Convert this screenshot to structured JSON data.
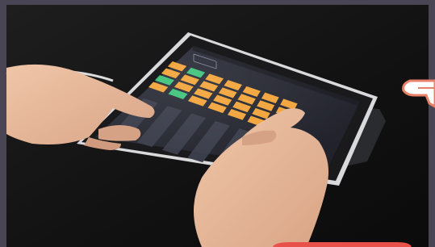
{
  "scene": {
    "subject": "hands-tapping-tablet",
    "colors": {
      "frame": "#4a4554",
      "desk": "#141414",
      "tablet_bezel": "#1a1a1c",
      "screen_bg": "#262833",
      "pad_orange": "#f2a43a",
      "pad_green": "#3ec27a",
      "fader": "#3a3d4a",
      "skin": "#e6b89a",
      "badge_red": "#e8504a",
      "pointer_outline": "#e8806a"
    }
  },
  "app": {
    "header_tab": "",
    "grid": {
      "rows": 4,
      "cols": 7,
      "lit_green": [
        [
          0,
          1
        ],
        [
          2,
          0
        ],
        [
          3,
          1
        ]
      ]
    },
    "faders": 6
  },
  "overlay": {
    "pointer_icon": "hand-pointer-icon",
    "badge_icon": "red-badge-icon"
  }
}
